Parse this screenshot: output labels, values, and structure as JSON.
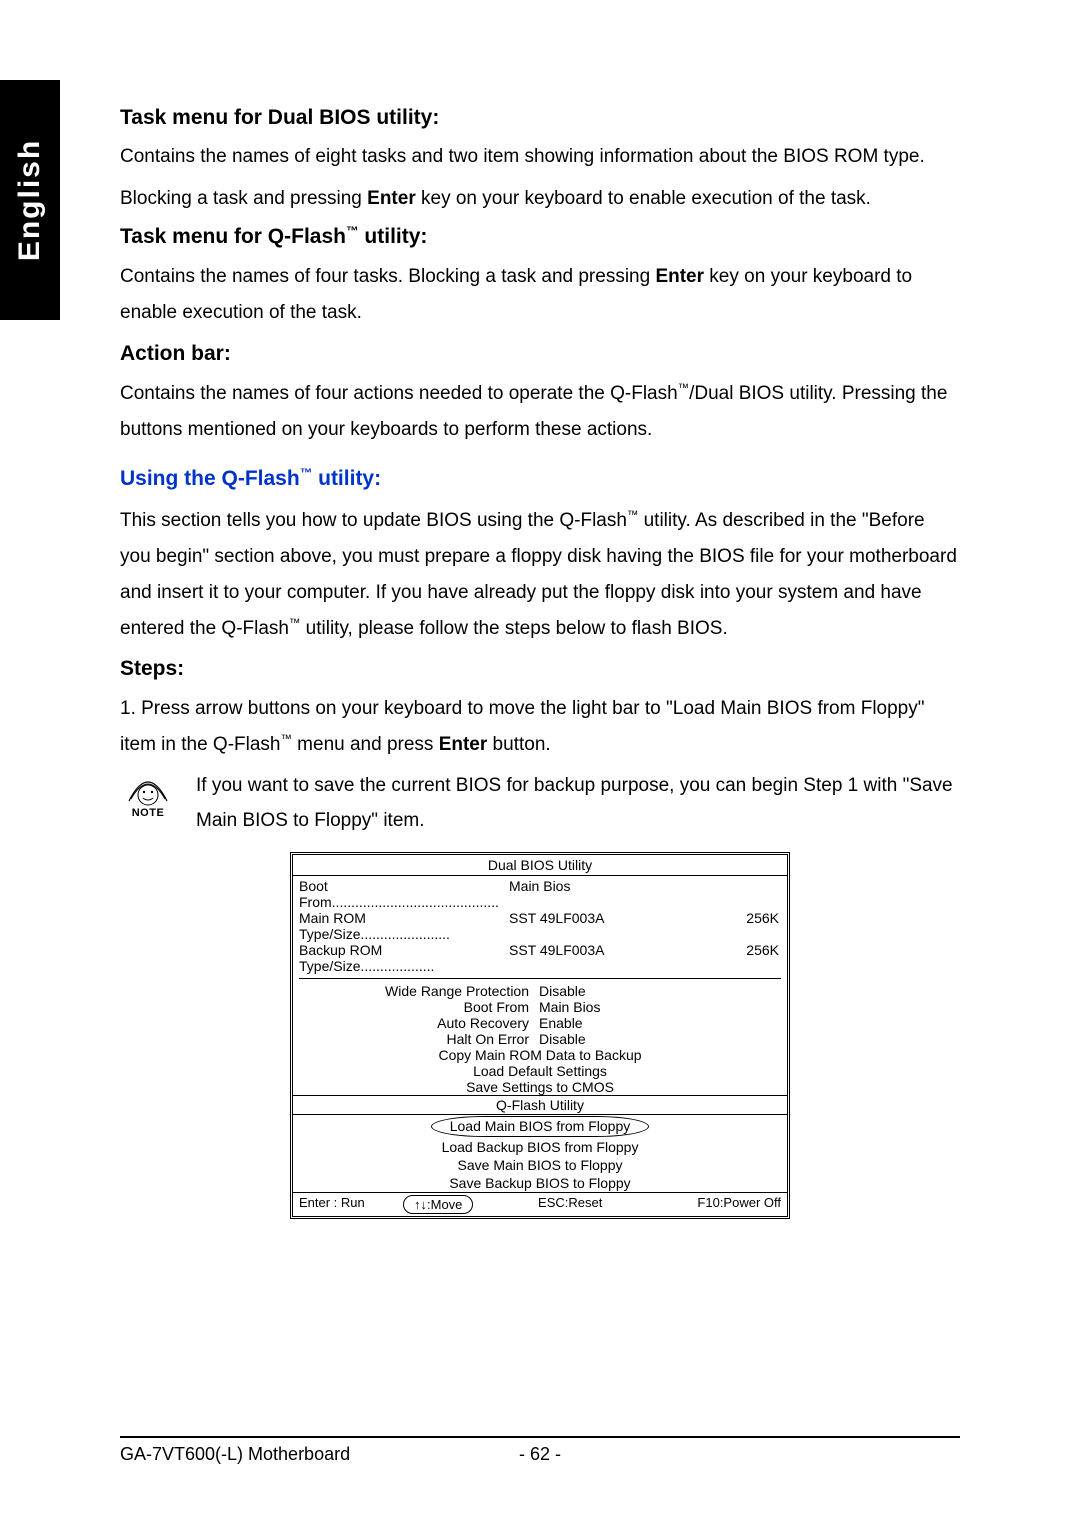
{
  "side_tab": "English",
  "sections": {
    "dual_bios_title": "Task menu for Dual BIOS utility:",
    "dual_bios_p1": "Contains the names of eight tasks and two item showing information about the BIOS ROM type.",
    "dual_bios_p2_a": "Blocking a task and pressing ",
    "dual_bios_p2_b": "Enter",
    "dual_bios_p2_c": " key on your keyboard to enable execution of the task.",
    "qflash_title_a": "Task menu for Q-Flash",
    "qflash_title_b": " utility:",
    "qflash_p_a": "Contains the names of four tasks. Blocking a task and pressing ",
    "qflash_p_b": "Enter",
    "qflash_p_c": " key on your keyboard to enable execution of the task.",
    "action_title": "Action bar:",
    "action_p_a": "Contains the names of four actions needed to operate the Q-Flash",
    "action_p_b": "/Dual BIOS utility. Pressing the buttons mentioned on your keyboards to perform these actions.",
    "using_title_a": "Using the Q-Flash",
    "using_title_b": " utility:",
    "using_p_a": "This section tells you how to update BIOS using the Q-Flash",
    "using_p_b": " utility. As described in the \"Before you begin\" section above, you must prepare a floppy disk having the BIOS file for your motherboard and insert it to your computer. If you have already put the floppy disk into your system and have entered the Q-Flash",
    "using_p_c": " utility, please follow the steps below to flash BIOS.",
    "steps_title": "Steps:",
    "step1_a": "1. Press arrow buttons on your keyboard to move the light bar to \"Load Main BIOS from Floppy\" item in the Q-Flash",
    "step1_b": " menu and press ",
    "step1_c": "Enter",
    "step1_d": " button.",
    "note_label": "NOTE",
    "note_text": "If you want to save the current BIOS for backup purpose, you can begin Step 1 with \"Save Main BIOS to Floppy\" item."
  },
  "bios": {
    "title": "Dual BIOS Utility",
    "info": [
      {
        "label": "Boot From",
        "value": "Main Bios",
        "size": ""
      },
      {
        "label": "Main ROM Type/Size",
        "value": "SST 49LF003A",
        "size": "256K"
      },
      {
        "label": "Backup ROM Type/Size",
        "value": "SST 49LF003A",
        "size": "256K"
      }
    ],
    "settings": [
      {
        "label": "Wide Range Protection",
        "value": "Disable"
      },
      {
        "label": "Boot From",
        "value": "Main Bios"
      },
      {
        "label": "Auto Recovery",
        "value": "Enable"
      },
      {
        "label": "Halt On Error",
        "value": "Disable"
      }
    ],
    "centered": [
      "Copy Main ROM Data to Backup",
      "Load Default Settings",
      "Save Settings to CMOS"
    ],
    "qflash_header": "Q-Flash Utility",
    "qflash_items": [
      "Load Main BIOS from Floppy",
      "Load Backup BIOS from Floppy",
      "Save Main BIOS to Floppy",
      "Save Backup BIOS to Floppy"
    ],
    "actions": {
      "a1": "Enter : Run",
      "a2": "↑↓:Move",
      "a3": "ESC:Reset",
      "a4": "F10:Power Off"
    }
  },
  "footer": {
    "left": "GA-7VT600(-L) Motherboard",
    "center": "- 62 -"
  }
}
